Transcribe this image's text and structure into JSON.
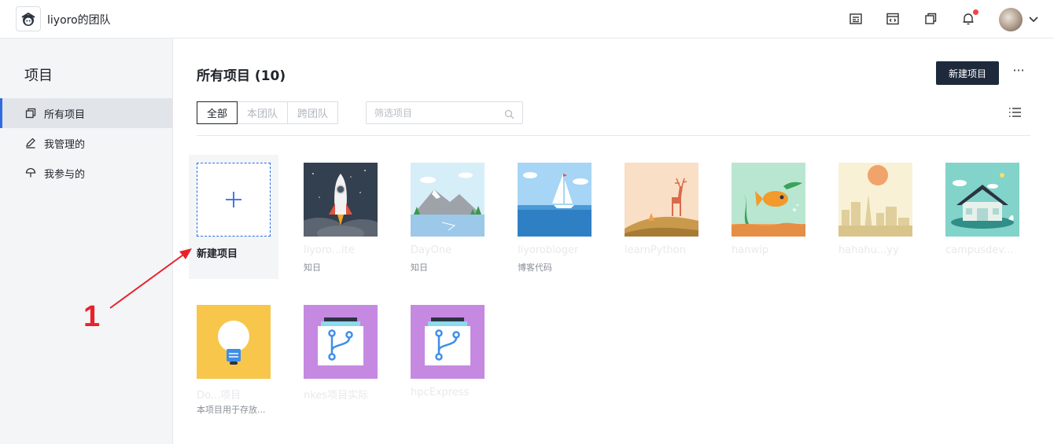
{
  "header": {
    "team_name": "liyoro的团队",
    "notification_dot_color": "#ef4444"
  },
  "sidebar": {
    "title": "项目",
    "items": [
      {
        "label": "所有项目",
        "icon": "copy-icon",
        "active": true
      },
      {
        "label": "我管理的",
        "icon": "pen-icon",
        "active": false
      },
      {
        "label": "我参与的",
        "icon": "umbrella-icon",
        "active": false
      }
    ]
  },
  "main": {
    "title": "所有项目 (10)",
    "new_button": "新建项目",
    "more": "···",
    "tabs": [
      "全部",
      "本团队",
      "跨团队"
    ],
    "search_placeholder": "筛选项目",
    "new_card_label": "新建项目",
    "projects": [
      {
        "name": "liyoro...ite",
        "desc": "知日",
        "thumb": "rocket"
      },
      {
        "name": "DayOne",
        "desc": "知日",
        "thumb": "mountain-lake"
      },
      {
        "name": "liyorobloger",
        "desc": "博客代码",
        "thumb": "sailboat"
      },
      {
        "name": "learnPython",
        "desc": "",
        "thumb": "deer"
      },
      {
        "name": "hanwip",
        "desc": "",
        "thumb": "fish"
      },
      {
        "name": "hahahu...yy",
        "desc": "",
        "thumb": "city-sun"
      },
      {
        "name": "campusdev...",
        "desc": "",
        "thumb": "house"
      },
      {
        "name": "Do...项目",
        "desc": "本项目用于存放...",
        "thumb": "lightbulb"
      },
      {
        "name": "nkes项目实际",
        "desc": "",
        "thumb": "git-branch"
      },
      {
        "name": "hpcExpress",
        "desc": "",
        "thumb": "git-branch"
      }
    ]
  },
  "annotation": {
    "number": "1",
    "color": "#e8222b"
  }
}
